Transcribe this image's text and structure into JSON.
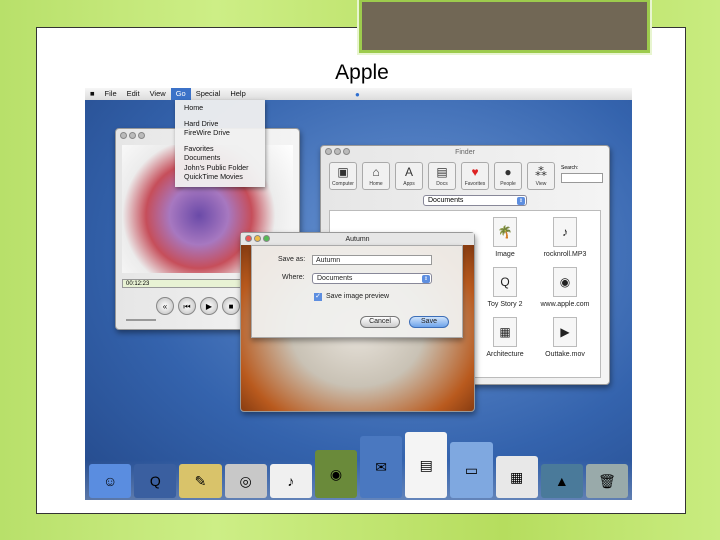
{
  "slide": {
    "title": "Apple"
  },
  "menubar": {
    "items": [
      "File",
      "Edit",
      "View",
      "Go",
      "Special",
      "Help"
    ],
    "selected": "Go"
  },
  "go_menu": {
    "items": [
      "Home",
      "Hard Drive",
      "FireWire Drive",
      "Favorites",
      "Documents",
      "John's Public Folder",
      "QuickTime Movies"
    ]
  },
  "quicktime": {
    "timecode": "00:12:23"
  },
  "finder": {
    "title": "Finder",
    "toolbar": [
      "Computer",
      "Home",
      "Apps",
      "Docs",
      "Favorites",
      "People",
      "View"
    ],
    "search_label": "Search:",
    "location": "Documents",
    "files": [
      "Image",
      "rocknroll.MP3",
      "Toy Story 2",
      "www.apple.com",
      "Architecture",
      "Outtake.mov"
    ]
  },
  "save_dialog": {
    "window_title": "Autumn",
    "save_as_label": "Save as:",
    "save_as_value": "Autumn",
    "where_label": "Where:",
    "where_value": "Documents",
    "checkbox_label": "Save image preview",
    "checkbox_checked": true,
    "cancel": "Cancel",
    "save": "Save"
  }
}
